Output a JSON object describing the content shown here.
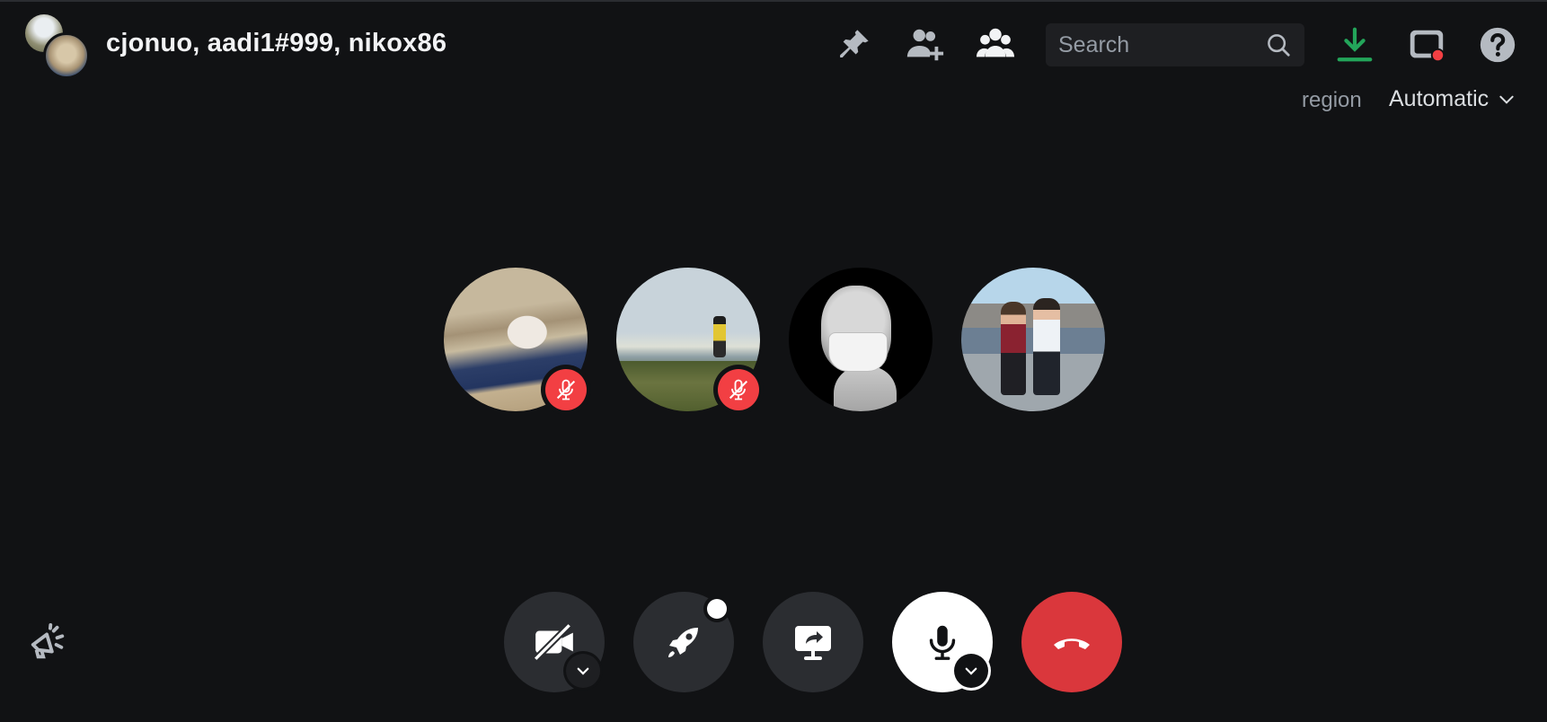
{
  "header": {
    "title": "cjonuo, aadi1#999, nikox86",
    "icons": [
      "pin-icon",
      "add-friend-icon",
      "members-icon"
    ],
    "search": {
      "placeholder": "Search",
      "icon": "search-icon"
    },
    "right_icons": [
      "download-icon",
      "inbox-icon",
      "help-icon"
    ]
  },
  "region": {
    "label": "region",
    "value": "Automatic"
  },
  "participants": [
    {
      "name": "cat-avatar",
      "muted": true
    },
    {
      "name": "hiker-avatar",
      "muted": true
    },
    {
      "name": "statue-avatar",
      "muted": false
    },
    {
      "name": "friends-avatar",
      "muted": false
    }
  ],
  "controls": [
    {
      "name": "camera-off",
      "icon": "camera-off-icon",
      "has_menu": true
    },
    {
      "name": "activities",
      "icon": "rocket-icon",
      "has_dot": true
    },
    {
      "name": "screen-share",
      "icon": "screen-share-icon"
    },
    {
      "name": "microphone",
      "icon": "microphone-icon",
      "has_menu": true
    },
    {
      "name": "disconnect",
      "icon": "hang-up-icon"
    }
  ],
  "colors": {
    "background": "#111214",
    "button": "#2b2d31",
    "danger": "#da373c",
    "mute_red": "#f23f43",
    "download_green": "#23a55a"
  }
}
